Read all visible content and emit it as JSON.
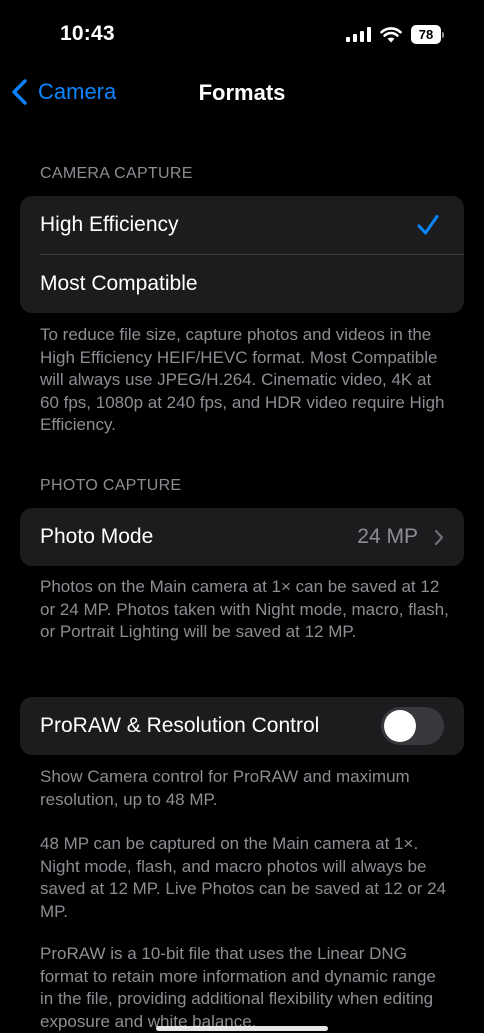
{
  "status_bar": {
    "time": "10:43",
    "battery": "78"
  },
  "nav": {
    "back_label": "Camera",
    "title": "Formats"
  },
  "camera_capture": {
    "header": "CAMERA CAPTURE",
    "options": [
      {
        "label": "High Efficiency",
        "selected": true
      },
      {
        "label": "Most Compatible",
        "selected": false
      }
    ],
    "footer": "To reduce file size, capture photos and videos in the High Efficiency HEIF/HEVC format. Most Compatible will always use JPEG/H.264. Cinematic video, 4K at 60 fps, 1080p at 240 fps, and HDR video require High Efficiency."
  },
  "photo_capture": {
    "header": "PHOTO CAPTURE",
    "row_label": "Photo Mode",
    "row_value": "24 MP",
    "footer": "Photos on the Main camera at 1× can be saved at 12 or 24 MP. Photos taken with Night mode, macro, flash, or Portrait Lighting will be saved at 12 MP."
  },
  "proraw": {
    "label": "ProRAW & Resolution Control",
    "enabled": false,
    "footer_1": "Show Camera control for ProRAW and maximum resolution, up to 48 MP.",
    "footer_2": "48 MP can be captured on the Main camera at 1×. Night mode, flash, and macro photos will always be saved at 12 MP. Live Photos can be saved at 12 or 24 MP.",
    "footer_3": "ProRAW is a 10-bit file that uses the Linear DNG format to retain more information and dynamic range in the file, providing additional flexibility when editing exposure and white balance."
  },
  "colors": {
    "accent": "#0a84ff",
    "background": "#000000",
    "cell": "#1c1c1e",
    "secondary_text": "#8d8d93"
  }
}
